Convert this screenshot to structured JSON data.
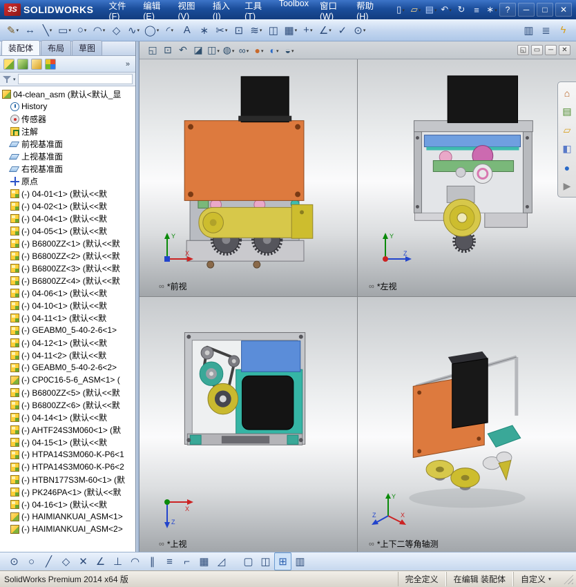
{
  "titlebar": {
    "logo": "3S",
    "brand": "SOLIDWORKS",
    "menus": [
      {
        "name": "menu-file",
        "label": "文件(F)"
      },
      {
        "name": "menu-edit",
        "label": "编辑(E)"
      },
      {
        "name": "menu-view",
        "label": "视图(V)"
      },
      {
        "name": "menu-insert",
        "label": "插入(I)"
      },
      {
        "name": "menu-tools",
        "label": "工具(T)"
      },
      {
        "name": "menu-toolbox",
        "label": "Toolbox"
      },
      {
        "name": "menu-window",
        "label": "窗口(W)"
      },
      {
        "name": "menu-help",
        "label": "帮助(H)"
      }
    ],
    "quick_access": [
      {
        "name": "new-document-button",
        "glyph": "▯",
        "dd": 1
      },
      {
        "name": "open-button",
        "glyph": "▱",
        "dd": 1,
        "color": "#ffd98a"
      },
      {
        "name": "save-button",
        "glyph": "▤",
        "dd": 1,
        "color": "#bcd4ff"
      },
      {
        "name": "undo-button",
        "glyph": "↶",
        "dd": 1
      },
      {
        "name": "rebuild-button",
        "glyph": "↻"
      },
      {
        "name": "file-properties-button",
        "glyph": "≡"
      },
      {
        "name": "options-button",
        "glyph": "∗",
        "dd": 1
      }
    ],
    "window_buttons": [
      {
        "name": "help-button",
        "glyph": "?"
      },
      {
        "name": "minimize-button",
        "glyph": "─"
      },
      {
        "name": "maximize-button",
        "glyph": "□"
      },
      {
        "name": "close-button",
        "glyph": "✕"
      }
    ]
  },
  "toolbar2": {
    "main": [
      {
        "name": "sketch-button",
        "glyph": "✎",
        "dd": 1,
        "color": "#7a5a20"
      },
      {
        "name": "smart-dimension-button",
        "glyph": "↔"
      },
      {
        "name": "line-tool-button",
        "glyph": "╲",
        "dd": 1
      },
      {
        "name": "rectangle-tool-button",
        "glyph": "▭",
        "dd": 1
      },
      {
        "name": "circle-tool-button",
        "glyph": "○",
        "dd": 1
      },
      {
        "name": "arc-tool-button",
        "glyph": "◠",
        "dd": 1
      },
      {
        "name": "polygon-tool-button",
        "glyph": "◇"
      },
      {
        "name": "spline-tool-button",
        "glyph": "∿",
        "dd": 1
      },
      {
        "name": "ellipse-tool-button",
        "glyph": "◯",
        "dd": 1
      },
      {
        "name": "fillet-tool-button",
        "glyph": "◜",
        "dd": 1
      },
      {
        "name": "text-tool-button",
        "glyph": "A"
      },
      {
        "name": "point-tool-button",
        "glyph": "∗"
      },
      {
        "name": "trim-entities-button",
        "glyph": "✂",
        "dd": 1
      },
      {
        "name": "convert-entities-button",
        "glyph": "⊡"
      },
      {
        "name": "offset-entities-button",
        "glyph": "≋",
        "dd": 1
      },
      {
        "name": "mirror-entities-button",
        "glyph": "◫"
      },
      {
        "name": "linear-pattern-button",
        "glyph": "▦",
        "dd": 1
      },
      {
        "name": "move-entities-button",
        "glyph": "+",
        "dd": 1
      },
      {
        "name": "display-relations-button",
        "glyph": "∠",
        "dd": 1
      },
      {
        "name": "repair-sketch-button",
        "glyph": "✓"
      },
      {
        "name": "quick-snaps-button",
        "glyph": "⊙",
        "dd": 1
      }
    ],
    "right": [
      {
        "name": "isolate-button",
        "glyph": "▥"
      },
      {
        "name": "assembly-visualization-button",
        "glyph": "≣"
      },
      {
        "name": "instant3d-button",
        "glyph": "ϟ",
        "color": "#d8a020"
      }
    ]
  },
  "panel": {
    "tabs": [
      {
        "name": "tab-assembly",
        "label": "装配体",
        "active": true
      },
      {
        "name": "tab-layout",
        "label": "布局"
      },
      {
        "name": "tab-sketch",
        "label": "草图"
      }
    ],
    "manager_icons": [
      {
        "name": "featuremanager-tab-icon",
        "bg": "linear-gradient(135deg,#ffdf6b 0 55%,#74aa32 55%)"
      },
      {
        "name": "propertymanager-tab-icon",
        "bg": "linear-gradient(135deg,#cde98a,#4a8a2a)"
      },
      {
        "name": "configurationmanager-tab-icon",
        "bg": "linear-gradient(135deg,#ffe9a0,#d8a020)"
      },
      {
        "name": "displaymanager-tab-icon",
        "bg": "conic-gradient(#e84a2a 0 25%,#2a7ae8 0 50%,#6ab82a 0 75%,#e8c42a 0)"
      }
    ],
    "chevron": "»",
    "tree": [
      {
        "icon": "asm-root",
        "cls": "root",
        "label": "04-clean_asm (默认<默认_显"
      },
      {
        "icon": "history",
        "label": "History"
      },
      {
        "icon": "sensors",
        "label": "传感器"
      },
      {
        "icon": "annotations",
        "label": "注解"
      },
      {
        "icon": "plane",
        "label": "前视基准面"
      },
      {
        "icon": "plane",
        "label": "上视基准面"
      },
      {
        "icon": "plane",
        "label": "右视基准面"
      },
      {
        "icon": "origin",
        "label": "原点"
      },
      {
        "icon": "component",
        "label": "(-) 04-01<1> (默认<<默"
      },
      {
        "icon": "component",
        "label": "(-) 04-02<1> (默认<<默"
      },
      {
        "icon": "component",
        "label": "(-) 04-04<1> (默认<<默"
      },
      {
        "icon": "component",
        "label": "(-) 04-05<1> (默认<<默"
      },
      {
        "icon": "component",
        "label": "(-) B6800ZZ<1> (默认<<默"
      },
      {
        "icon": "component",
        "label": "(-) B6800ZZ<2> (默认<<默"
      },
      {
        "icon": "component",
        "label": "(-) B6800ZZ<3> (默认<<默"
      },
      {
        "icon": "component",
        "label": "(-) B6800ZZ<4> (默认<<默"
      },
      {
        "icon": "component",
        "label": "(-) 04-06<1> (默认<<默"
      },
      {
        "icon": "component",
        "label": "(-) 04-10<1> (默认<<默"
      },
      {
        "icon": "component",
        "label": "(-) 04-11<1> (默认<<默"
      },
      {
        "icon": "component",
        "label": "(-) GEABM0_5-40-2-6<1>"
      },
      {
        "icon": "component",
        "label": "(-) 04-12<1> (默认<<默"
      },
      {
        "icon": "component",
        "label": "(-) 04-11<2> (默认<<默"
      },
      {
        "icon": "component",
        "label": "(-) GEABM0_5-40-2-6<2>"
      },
      {
        "icon": "subasm",
        "label": "(-) CP0C16-5-6_ASM<1> ("
      },
      {
        "icon": "component",
        "label": "(-) B6800ZZ<5> (默认<<默"
      },
      {
        "icon": "component",
        "label": "(-) B6800ZZ<6> (默认<<默"
      },
      {
        "icon": "component",
        "label": "(-) 04-14<1> (默认<<默"
      },
      {
        "icon": "component",
        "label": "(-) AHTF24S3M060<1> (默"
      },
      {
        "icon": "component",
        "label": "(-) 04-15<1> (默认<<默"
      },
      {
        "icon": "component",
        "label": "(-) HTPA14S3M060-K-P6<1"
      },
      {
        "icon": "component",
        "label": "(-) HTPA14S3M060-K-P6<2"
      },
      {
        "icon": "component",
        "label": "(-) HTBN177S3M-60<1> (默"
      },
      {
        "icon": "component",
        "label": "(-) PK246PA<1> (默认<<默"
      },
      {
        "icon": "component",
        "label": "(-) 04-16<1> (默认<<默"
      },
      {
        "icon": "subasm",
        "label": "(-) HAIMIANKUAI_ASM<1>"
      },
      {
        "icon": "subasm",
        "label": "(-) HAIMIANKUAI_ASM<2>"
      }
    ]
  },
  "hud": {
    "icons": [
      {
        "name": "zoom-fit-button",
        "glyph": "◱"
      },
      {
        "name": "zoom-area-button",
        "glyph": "⊡"
      },
      {
        "name": "previous-view-button",
        "glyph": "↶"
      },
      {
        "name": "section-view-button",
        "glyph": "◪"
      },
      {
        "name": "view-orientation-button",
        "glyph": "◫",
        "dd": 1
      },
      {
        "name": "display-style-button",
        "glyph": "◍",
        "dd": 1
      },
      {
        "name": "hide-show-items-button",
        "glyph": "∞",
        "dd": 1
      },
      {
        "name": "edit-appearance-button",
        "glyph": "●",
        "dd": 1,
        "color": "#c8692a"
      },
      {
        "name": "apply-scene-button",
        "glyph": "◐",
        "dd": 1,
        "color": "#2a6ac8"
      },
      {
        "name": "view-settings-button",
        "glyph": "◒",
        "dd": 1
      }
    ],
    "window_buttons": [
      {
        "name": "viewport-layout-button",
        "glyph": "◱"
      },
      {
        "name": "maximize-viewport-button",
        "glyph": "▭"
      },
      {
        "name": "minimize-viewport-button",
        "glyph": "─"
      },
      {
        "name": "close-viewport-button",
        "glyph": "✕"
      }
    ]
  },
  "taskpane": [
    {
      "name": "home-icon",
      "glyph": "⌂",
      "color": "#b85c1a"
    },
    {
      "name": "design-library-icon",
      "glyph": "▤",
      "color": "#4a8a2a"
    },
    {
      "name": "file-explorer-icon",
      "glyph": "▱",
      "color": "#d8a020"
    },
    {
      "name": "view-palette-icon",
      "glyph": "◧",
      "color": "#5a7ac8"
    },
    {
      "name": "appearances-icon",
      "glyph": "●",
      "color": "#2a6ac8"
    },
    {
      "name": "custom-properties-icon",
      "glyph": "▶",
      "color": "#888888"
    }
  ],
  "viewports": [
    {
      "label": "*前视",
      "axes": [
        "Y",
        "X"
      ]
    },
    {
      "label": "*左视",
      "axes": [
        "Y",
        "Z"
      ]
    },
    {
      "label": "*上视",
      "axes": [
        "X",
        "Z"
      ]
    },
    {
      "label": "*上下二等角轴测",
      "axes": [
        "Y",
        "X",
        "Z"
      ]
    }
  ],
  "bottom_toolbar": {
    "snaps": [
      {
        "name": "point-snap-button",
        "glyph": "⊙"
      },
      {
        "name": "center-snap-button",
        "glyph": "○"
      },
      {
        "name": "line-snap-button",
        "glyph": "╱"
      },
      {
        "name": "midpoint-snap-button",
        "glyph": "◇"
      },
      {
        "name": "intersection-snap-button",
        "glyph": "✕"
      },
      {
        "name": "angle-snap-button",
        "glyph": "∠"
      },
      {
        "name": "perpendicular-snap-button",
        "glyph": "⊥"
      },
      {
        "name": "tangent-snap-button",
        "glyph": "◠"
      },
      {
        "name": "parallel-snap-button",
        "glyph": "∥"
      },
      {
        "name": "hv-snap-button",
        "glyph": "≡"
      },
      {
        "name": "length-snap-button",
        "glyph": "⌐"
      },
      {
        "name": "grid-snap-button",
        "glyph": "▦"
      },
      {
        "name": "angle-bisector-snap-button",
        "glyph": "◿"
      }
    ],
    "views": [
      {
        "name": "single-view-button",
        "glyph": "▢"
      },
      {
        "name": "two-view-button",
        "glyph": "◫"
      },
      {
        "name": "four-view-button",
        "glyph": "⊞",
        "active": true
      },
      {
        "name": "link-views-button",
        "glyph": "▥"
      }
    ]
  },
  "statusbar": {
    "left": "SolidWorks Premium 2014 x64 版",
    "defined": "完全定义",
    "editing": "在编辑 装配体",
    "custom": "自定义"
  }
}
